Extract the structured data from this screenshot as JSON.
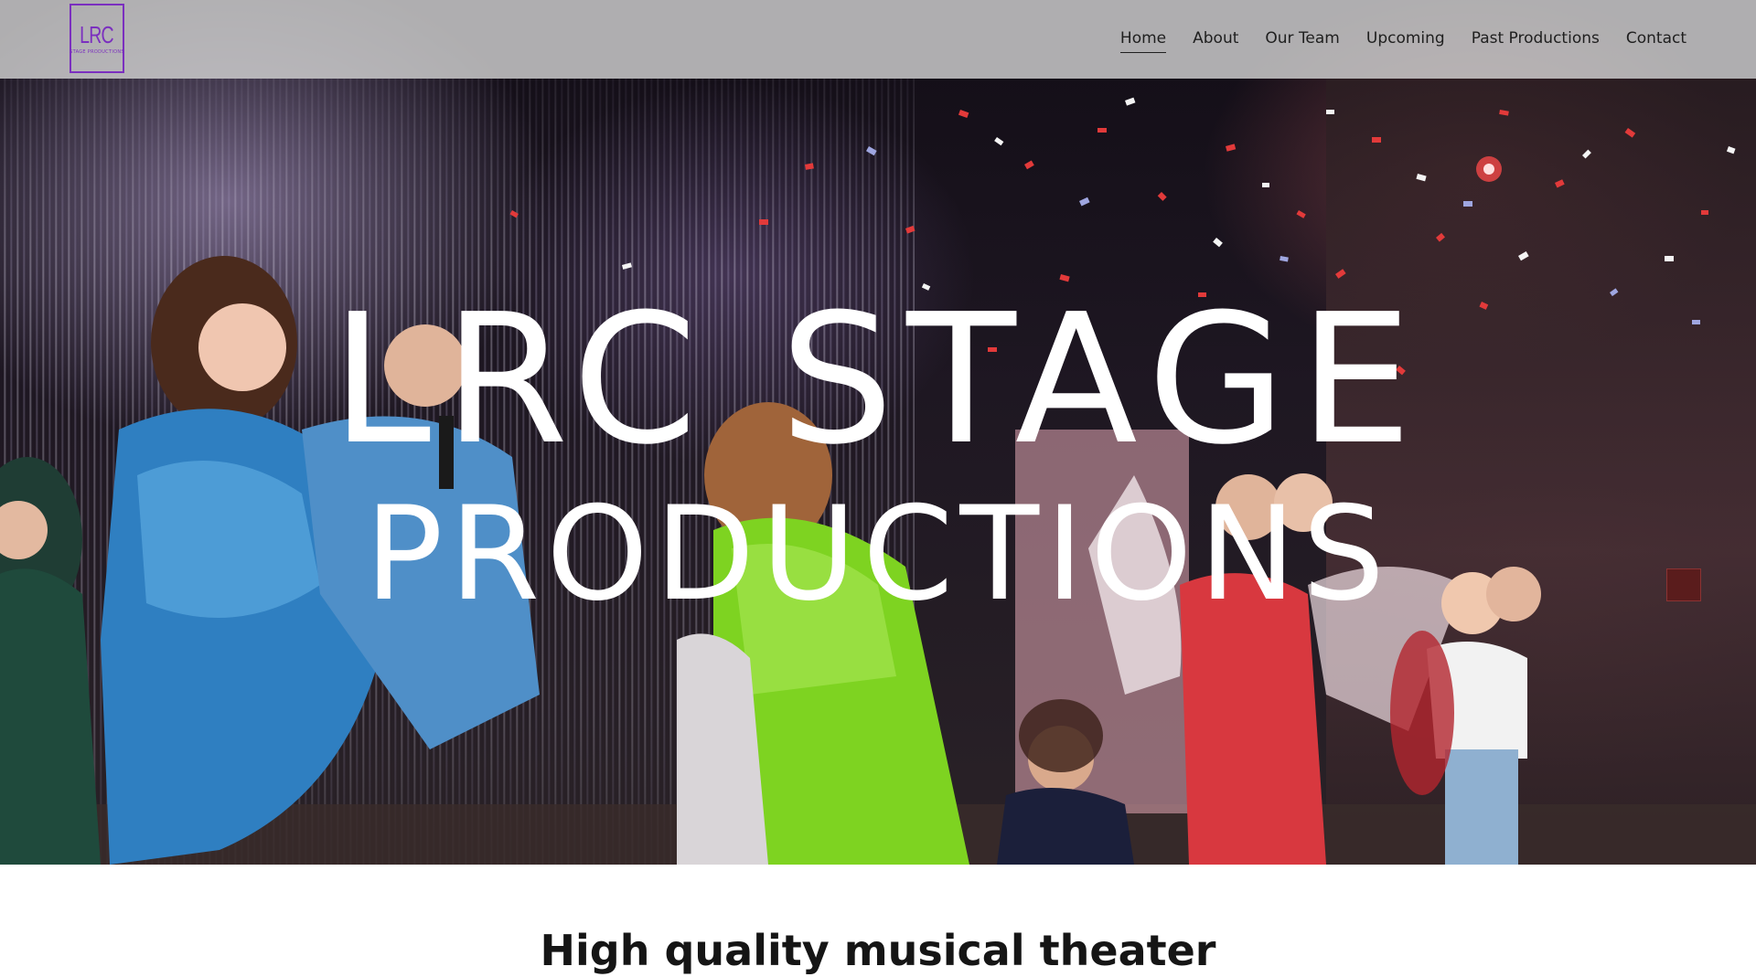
{
  "site": {
    "logo": {
      "main": "LRC",
      "sub": "STAGE PRODUCTIONS",
      "color": "#7b2fbf"
    }
  },
  "nav": {
    "items": [
      {
        "label": "Home",
        "active": true
      },
      {
        "label": "About"
      },
      {
        "label": "Our Team"
      },
      {
        "label": "Upcoming"
      },
      {
        "label": "Past Productions"
      },
      {
        "label": "Contact"
      }
    ]
  },
  "hero": {
    "title_line1": "LRC STAGE",
    "title_line2": "PRODUCTIONS"
  },
  "section": {
    "tagline": "High quality musical theater"
  },
  "icons": [
    "exit-sign-icon"
  ]
}
